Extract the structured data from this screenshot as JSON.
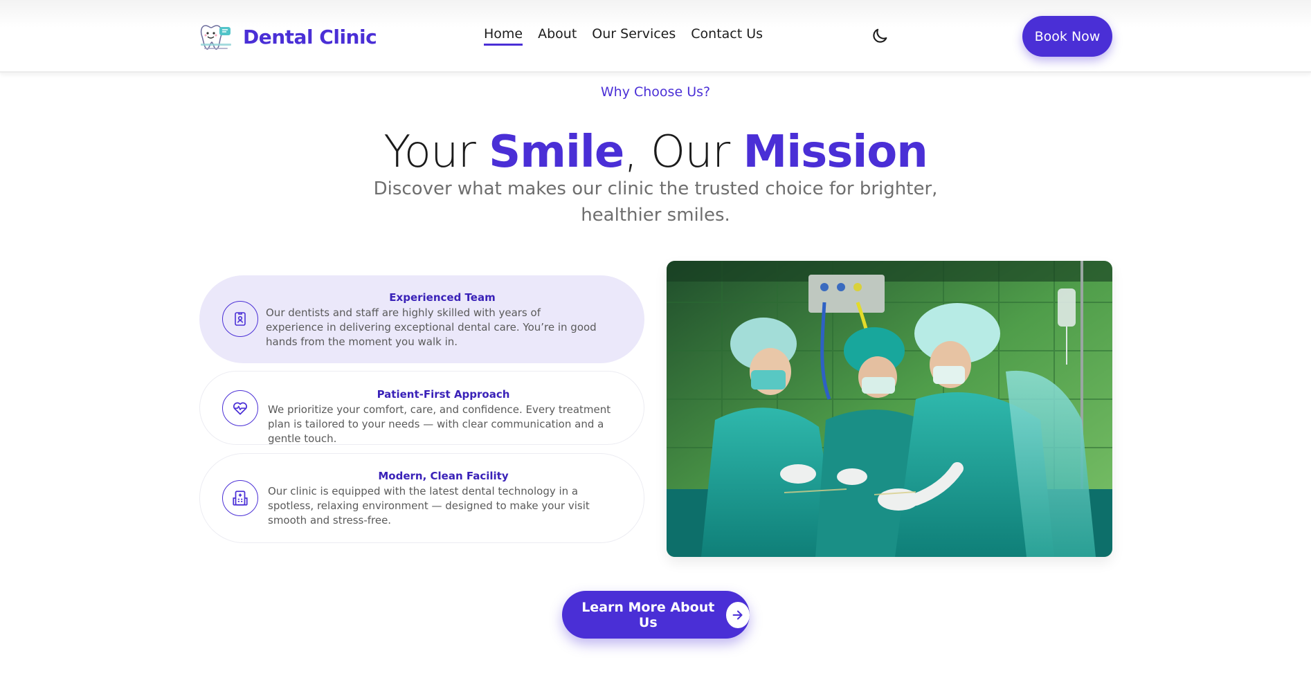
{
  "brand": {
    "name": "Dental Clinic",
    "logo_icon": "tooth-logo-icon",
    "accent_color": "#4a2fd6"
  },
  "nav": {
    "items": [
      {
        "label": "Home",
        "active": true
      },
      {
        "label": "About",
        "active": false
      },
      {
        "label": "Our Services",
        "active": false
      },
      {
        "label": "Contact Us",
        "active": false
      }
    ],
    "theme_toggle_icon": "moon-icon",
    "book_label": "Book Now"
  },
  "hero": {
    "eyebrow": "Why Choose Us?",
    "title": {
      "part1": "Your ",
      "accent1": "Smile",
      "part2": ", Our ",
      "accent2": "Mission"
    },
    "subtitle": "Discover what makes our clinic the trusted choice for brighter, healthier smiles."
  },
  "features": [
    {
      "title": "Experienced Team",
      "text": "Our dentists and staff are highly skilled with years of experience in delivering exceptional dental care. You’re in good hands from the moment you walk in.",
      "icon": "id-badge-icon",
      "active": true
    },
    {
      "title": "Patient-First Approach",
      "text": "We prioritize your comfort, care, and confidence. Every treatment plan is tailored to your needs — with clear communication and a gentle touch.",
      "icon": "heart-pulse-icon",
      "active": false
    },
    {
      "title": "Modern, Clean Facility",
      "text": "Our clinic is equipped with the latest dental technology in a spotless, relaxing environment — designed to make your visit smooth and stress-free.",
      "icon": "hospital-building-icon",
      "active": false
    }
  ],
  "cta": {
    "label": "Learn More About Us",
    "icon": "arrow-right-icon"
  }
}
